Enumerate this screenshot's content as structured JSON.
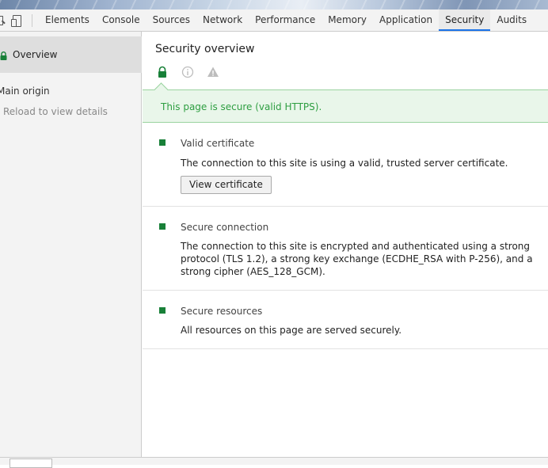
{
  "toolbar": {
    "tabs": [
      {
        "label": "Elements"
      },
      {
        "label": "Console"
      },
      {
        "label": "Sources"
      },
      {
        "label": "Network"
      },
      {
        "label": "Performance"
      },
      {
        "label": "Memory"
      },
      {
        "label": "Application"
      },
      {
        "label": "Security",
        "active": true
      },
      {
        "label": "Audits"
      }
    ]
  },
  "sidebar": {
    "overview_label": "Overview",
    "main_origin_label": "Main origin",
    "reload_label": "Reload to view details"
  },
  "main": {
    "title": "Security overview",
    "banner_text": "This page is secure (valid HTTPS).",
    "sections": [
      {
        "title": "Valid certificate",
        "description": "The connection to this site is using a valid, trusted server certificate.",
        "button_label": "View certificate"
      },
      {
        "title": "Secure connection",
        "description_lines": [
          "The connection to this site is encrypted and authenticated using a strong",
          "protocol (TLS 1.2), a strong key exchange (ECDHE_RSA with P-256), and a",
          "strong cipher (AES_128_GCM)."
        ]
      },
      {
        "title": "Secure resources",
        "description": "All resources on this page are served securely."
      }
    ]
  },
  "colors": {
    "secure_green": "#188038",
    "banner_text": "#2e9e41",
    "banner_bg": "#e9f6ea",
    "active_tab_underline": "#1a73e8"
  },
  "icons": {
    "toolbar": [
      "inspect-icon",
      "device-toggle-icon"
    ],
    "filters": [
      "lock-icon",
      "info-icon",
      "warning-icon"
    ]
  }
}
